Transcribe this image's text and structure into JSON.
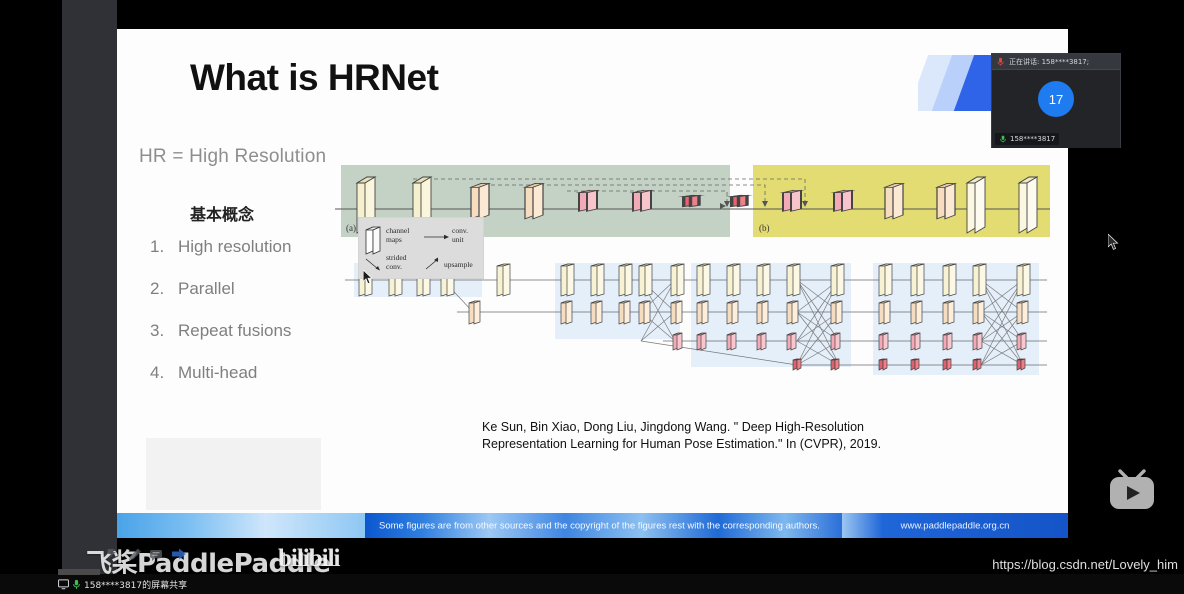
{
  "slide": {
    "title": "What is HRNet",
    "subtitle": "HR = High Resolution",
    "section_heading": "基本概念",
    "bullets": [
      {
        "num": "1.",
        "label": "High resolution"
      },
      {
        "num": "2.",
        "label": "Parallel"
      },
      {
        "num": "3.",
        "label": "Repeat fusions"
      },
      {
        "num": "4.",
        "label": "Multi-head"
      }
    ],
    "citation": "Ke Sun, Bin Xiao, Dong Liu, Jingdong Wang. \" Deep High-Resolution Representation Learning for Human Pose Estimation.\" In (CVPR), 2019.",
    "ribbon_glyph": "飞",
    "footer": {
      "notice": "Some figures are from other sources and the copyright of the figures rest with the corresponding authors.",
      "url": "www.paddlepaddle.org.cn"
    }
  },
  "diagram_top": {
    "label_a": "(a)",
    "label_b": "(b)",
    "panel_a_color": "#c3d2c5",
    "panel_b_color": "#e3dc72"
  },
  "diagram_bottom": {
    "legend": {
      "channel_maps": "channel\nmaps",
      "conv_unit": "conv.\nunit",
      "strided_conv": "strided\nconv.",
      "upsample": "upsample"
    },
    "legend_items": [
      "channel maps",
      "conv. unit",
      "strided conv.",
      "upsample"
    ],
    "stage_color": "#e5effa"
  },
  "watermark": {
    "paddle": "飞桨PaddlePaddle",
    "bilibili": "bilibili",
    "blog_url": "https://blog.csdn.net/Lovely_him"
  },
  "meeting": {
    "header_text": "正在讲话: 158****3817;",
    "avatar_initials": "17",
    "participant_name": "158****3817",
    "accent": "#1f7bf0"
  },
  "statusbar": {
    "text": "158****3817的屏幕共享"
  }
}
